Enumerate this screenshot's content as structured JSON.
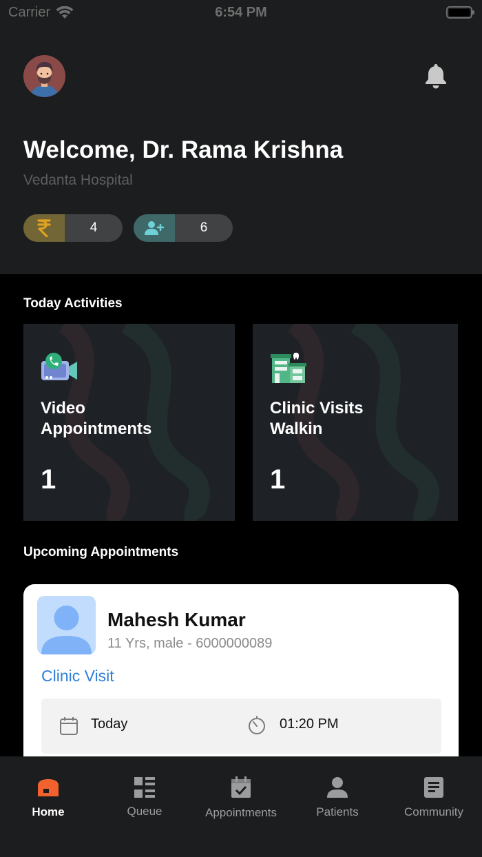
{
  "status_bar": {
    "carrier": "Carrier",
    "time": "6:54 PM"
  },
  "header": {
    "welcome": "Welcome, Dr. Rama Krishna",
    "hospital": "Vedanta Hospital",
    "earnings_count": "4",
    "patients_count": "6"
  },
  "activities": {
    "title": "Today Activities",
    "cards": [
      {
        "title_line1": "Video",
        "title_line2": "Appointments",
        "count": "1",
        "icon": "video-call-icon"
      },
      {
        "title_line1": "Clinic Visits",
        "title_line2": "Walkin",
        "count": "1",
        "icon": "clinic-building-icon"
      }
    ]
  },
  "upcoming": {
    "title": "Upcoming Appointments",
    "appointment": {
      "patient_name": "Mahesh Kumar",
      "patient_meta": "11 Yrs, male - 6000000089",
      "visit_type": "Clinic Visit",
      "date": "Today",
      "time": "01:20 PM"
    }
  },
  "tabs": [
    {
      "label": "Home",
      "icon": "home-icon",
      "active": true
    },
    {
      "label": "Queue",
      "icon": "queue-icon",
      "active": false
    },
    {
      "label": "Appointments",
      "icon": "calendar-check-icon",
      "active": false
    },
    {
      "label": "Patients",
      "icon": "person-icon",
      "active": false
    },
    {
      "label": "Community",
      "icon": "document-icon",
      "active": false
    }
  ],
  "colors": {
    "accent_orange": "#f2622e",
    "link_blue": "#2f80d6",
    "header_bg": "#1c1d1e",
    "page_bg": "#000000"
  }
}
